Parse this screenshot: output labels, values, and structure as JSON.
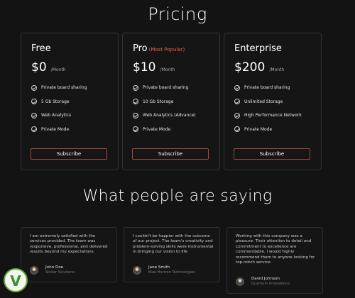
{
  "pricing": {
    "title": "Pricing",
    "plans": [
      {
        "name": "Free",
        "tag": "",
        "price": "$0",
        "period": "/Month",
        "features": [
          "Private board sharing",
          "5 Gb Storage",
          "Web Analytics",
          "Private Mode"
        ],
        "cta": "Subscribe"
      },
      {
        "name": "Pro",
        "tag": "(Most Popular)",
        "price": "$10",
        "period": "/Month",
        "features": [
          "Private board sharing",
          "10 Gb Storage",
          "Web Analytics (Advance)",
          "Private Mode"
        ],
        "cta": "Subscribe"
      },
      {
        "name": "Enterprise",
        "tag": "",
        "price": "$200",
        "period": "/Month",
        "features": [
          "Private board sharing",
          "Unlimited Storage",
          "High Performance Network",
          "Private Mode"
        ],
        "cta": "Subscribe"
      }
    ]
  },
  "testimonials": {
    "title": "What people are saying",
    "items": [
      {
        "quote": "I am extremely satisfied with the services provided. The team was responsive, professional, and delivered results beyond my expectations.",
        "name": "John Doe",
        "company": "Stellar Solutions"
      },
      {
        "quote": "I couldn't be happier with the outcome of our project. The team's creativity and problem-solving skills were instrumental in bringing our vision to life",
        "name": "Jane Smith",
        "company": "Blue Horizon Technologies"
      },
      {
        "quote": "Working with this company was a pleasure. Their attention to detail and commitment to excellence are commendable. I would highly recommend them to anyone looking for top-notch service.",
        "name": "David Johnson",
        "company": "Quantum Innovations"
      }
    ]
  },
  "theme": {
    "background": "#131313",
    "accent": "#e4634c",
    "button_border": "#a2493d"
  },
  "icons": {
    "feature_bullet": "check-circle-icon",
    "author_photo": "avatar",
    "watermark": "logo-watermark"
  }
}
